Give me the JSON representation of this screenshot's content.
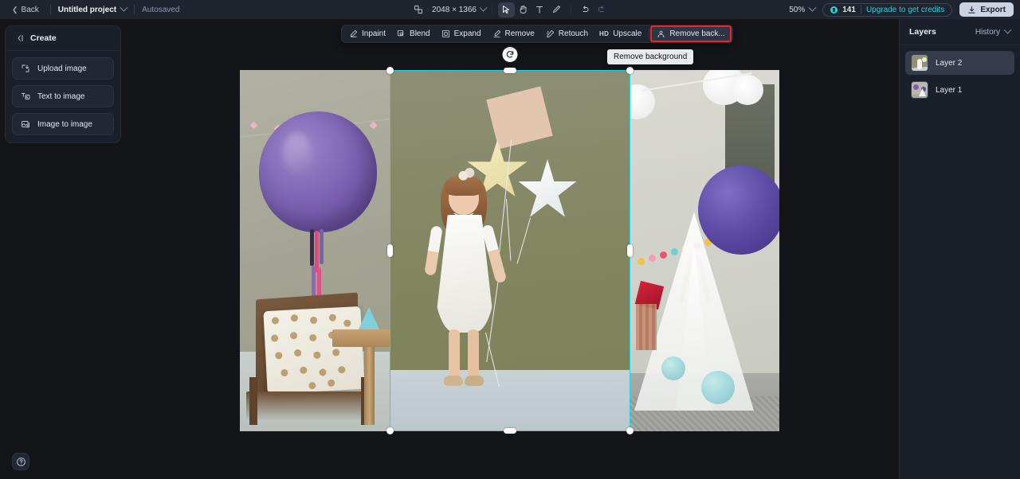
{
  "topbar": {
    "back_label": "Back",
    "project_name": "Untitled project",
    "autosave_label": "Autosaved",
    "canvas_size": "2048 × 1366",
    "zoom_level": "50%",
    "credits_count": "141",
    "upgrade_label": "Upgrade to get credits",
    "export_label": "Export",
    "tools": [
      {
        "name": "select-tool",
        "glyph": "cursor",
        "active": true
      },
      {
        "name": "hand-tool",
        "glyph": "hand",
        "active": false
      },
      {
        "name": "text-tool",
        "glyph": "T",
        "active": false
      },
      {
        "name": "brush-tool",
        "glyph": "brush",
        "active": false
      },
      {
        "name": "undo",
        "glyph": "undo",
        "active": false
      },
      {
        "name": "redo",
        "glyph": "redo",
        "active": false
      }
    ]
  },
  "left_panel": {
    "title": "Create",
    "items": [
      {
        "label": "Upload image",
        "icon": "upload-image-icon"
      },
      {
        "label": "Text to image",
        "icon": "text-to-image-icon"
      },
      {
        "label": "Image to image",
        "icon": "image-to-image-icon"
      }
    ]
  },
  "float_toolbar": {
    "items": [
      {
        "label": "Inpaint",
        "icon": "inpaint-icon",
        "highlighted": false
      },
      {
        "label": "Blend",
        "icon": "blend-icon",
        "highlighted": false
      },
      {
        "label": "Expand",
        "icon": "expand-icon",
        "highlighted": false
      },
      {
        "label": "Remove",
        "icon": "remove-icon",
        "highlighted": false
      },
      {
        "label": "Retouch",
        "icon": "retouch-icon",
        "highlighted": false
      },
      {
        "label": "Upscale",
        "icon": "hd-icon",
        "highlighted": false
      },
      {
        "label": "Remove back...",
        "icon": "remove-background-icon",
        "highlighted": true
      }
    ],
    "tooltip": "Remove background"
  },
  "right_panel": {
    "title": "Layers",
    "history_label": "History",
    "layers": [
      {
        "label": "Layer 2",
        "selected": true
      },
      {
        "label": "Layer 1",
        "selected": false
      }
    ]
  },
  "colors": {
    "accent": "#2ecddc",
    "selection": "#22d3ee",
    "highlight": "#e8242c",
    "panel_bg": "#1b1f29",
    "canvas_bg": "#131519"
  }
}
